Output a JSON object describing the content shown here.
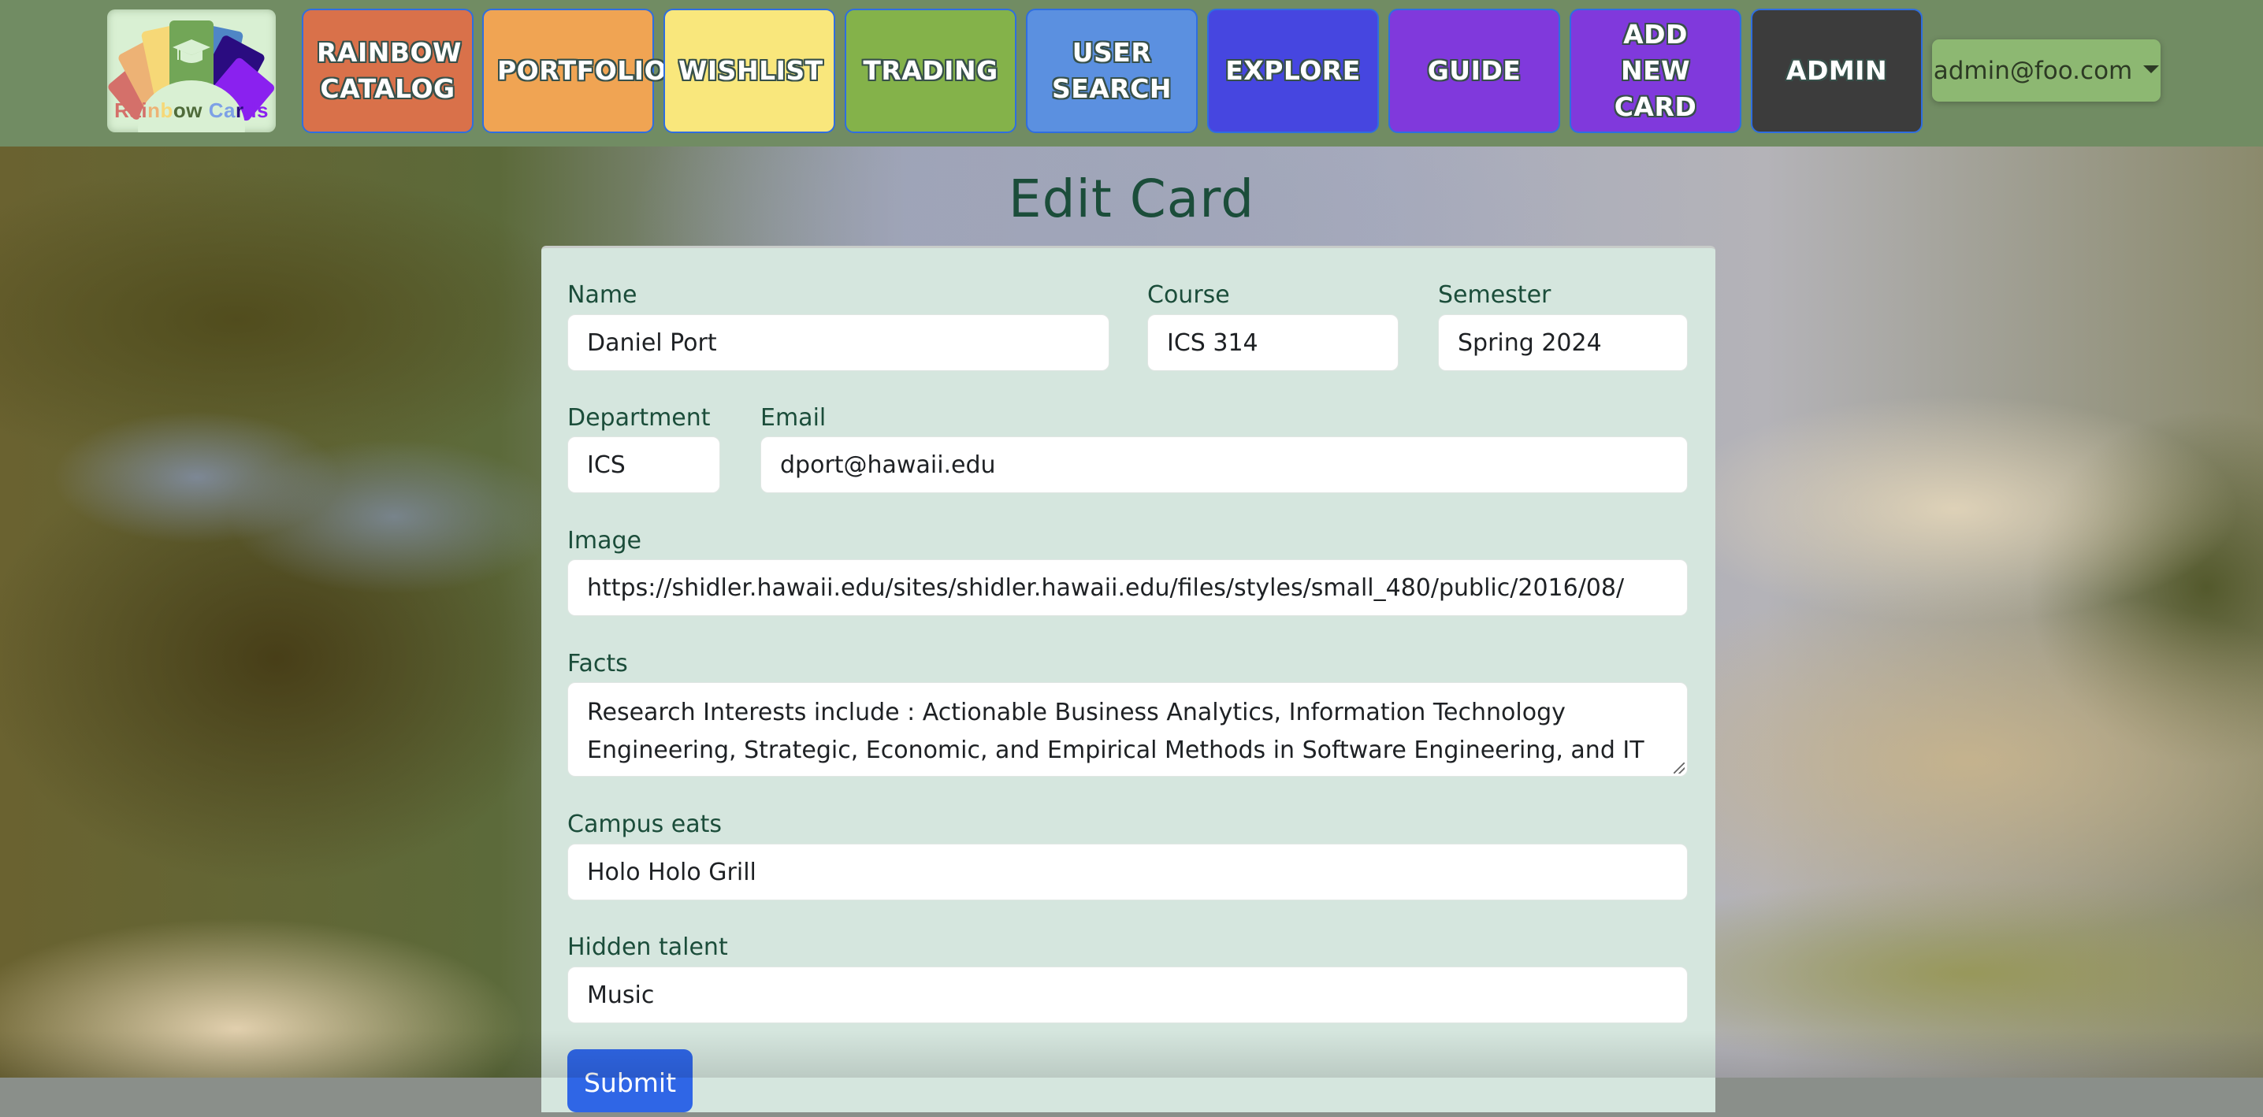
{
  "navbar": {
    "logo": {
      "text_parts": [
        "Rai",
        "n",
        "b",
        "ow",
        " ",
        "Ca",
        "r",
        "ds"
      ],
      "alt": "Rainbow Cards",
      "icon": "graduation-cap-icon"
    },
    "items": [
      {
        "label": "RAINBOW CATALOG",
        "color": "#d9714a"
      },
      {
        "label": "PORTFOLIO",
        "color": "#f0a453"
      },
      {
        "label": "WISHLIST",
        "color": "#f9e77c"
      },
      {
        "label": "TRADING",
        "color": "#84b24a"
      },
      {
        "label": "USER SEARCH",
        "color": "#5b90e0"
      },
      {
        "label": "EXPLORE",
        "color": "#4646e0"
      },
      {
        "label": "GUIDE",
        "color": "#8039dc"
      },
      {
        "label": "ADD NEW CARD",
        "color": "#8039dc"
      },
      {
        "label": "ADMIN",
        "color": "#3c3c3c"
      }
    ],
    "user_menu": {
      "label": "admin@foo.com",
      "icon": "caret-down-icon"
    }
  },
  "page": {
    "title": "Edit Card"
  },
  "form": {
    "name": {
      "label": "Name",
      "value": "Daniel Port"
    },
    "course": {
      "label": "Course",
      "value": "ICS 314"
    },
    "semester": {
      "label": "Semester",
      "value": "Spring 2024"
    },
    "department": {
      "label": "Department",
      "value": "ICS"
    },
    "email": {
      "label": "Email",
      "value": "dport@hawaii.edu"
    },
    "image": {
      "label": "Image",
      "value": "https://shidler.hawaii.edu/sites/shidler.hawaii.edu/files/styles/small_480/public/2016/08/"
    },
    "facts": {
      "label": "Facts",
      "value": "Research Interests include : Actionable Business Analytics, Information Technology Engineering, Strategic, Economic, and Empirical Methods in Software Engineering, and IT"
    },
    "campus_eats": {
      "label": "Campus eats",
      "value": "Holo Holo Grill"
    },
    "hidden_talent": {
      "label": "Hidden talent",
      "value": "Music"
    },
    "submit_label": "Submit"
  },
  "colors": {
    "navbar_bg": "#718c63",
    "panel_bg": "#d5e6de",
    "label_text": "#1b4d3a",
    "submit_bg": "#2f66e6",
    "user_menu_bg": "#8db872"
  }
}
